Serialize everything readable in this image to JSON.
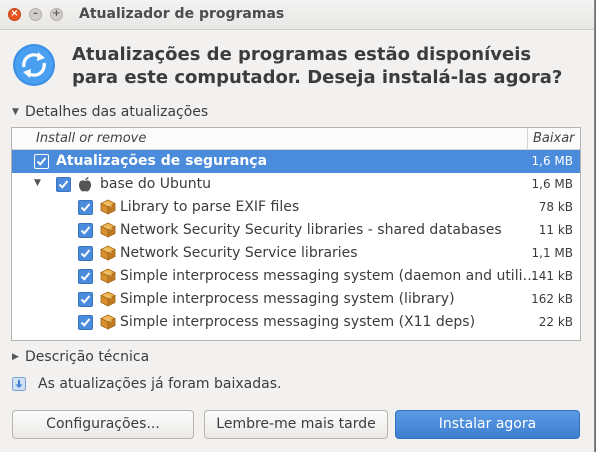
{
  "window": {
    "title": "Atualizador de programas",
    "controls": {
      "close": "×",
      "minimize": "–",
      "maximize": "+"
    }
  },
  "header": {
    "icon": "update-arrows-icon",
    "message": "Atualizações de programas estão disponíveis para este computador. Deseja instalá-las agora?"
  },
  "details_expander": {
    "label": "Detalhes das atualizações",
    "expanded": true
  },
  "updates": {
    "columns": {
      "name": "Install or remove",
      "size": "Baixar"
    },
    "group": {
      "label": "Atualizações de segurança",
      "size": "1,6 MB",
      "checked": true,
      "selected": true
    },
    "source": {
      "label": "base do Ubuntu",
      "size": "1,6 MB",
      "checked": true,
      "icon": "apple-icon"
    },
    "packages": [
      {
        "label": "Library to parse EXIF files",
        "size": "78 kB",
        "checked": true,
        "icon": "package-icon"
      },
      {
        "label": "Network Security Security libraries - shared databases",
        "size": "11 kB",
        "checked": true,
        "icon": "package-icon"
      },
      {
        "label": "Network Security Service libraries",
        "size": "1,1 MB",
        "checked": true,
        "icon": "package-icon"
      },
      {
        "label": "Simple interprocess messaging system (daemon and utili…",
        "size": "141 kB",
        "checked": true,
        "icon": "package-icon"
      },
      {
        "label": "Simple interprocess messaging system (library)",
        "size": "162 kB",
        "checked": true,
        "icon": "package-icon"
      },
      {
        "label": "Simple interprocess messaging system (X11 deps)",
        "size": "22 kB",
        "checked": true,
        "icon": "package-icon"
      }
    ]
  },
  "technical_expander": {
    "label": "Descrição técnica",
    "expanded": false
  },
  "status": {
    "icon": "download-icon",
    "text": "As atualizações já foram baixadas."
  },
  "buttons": {
    "settings": "Configurações...",
    "remind_later": "Lembre-me mais tarde",
    "install_now": "Instalar agora"
  },
  "colors": {
    "accent": "#4a8bdc",
    "close": "#e95420",
    "background": "#f2f1f0"
  }
}
